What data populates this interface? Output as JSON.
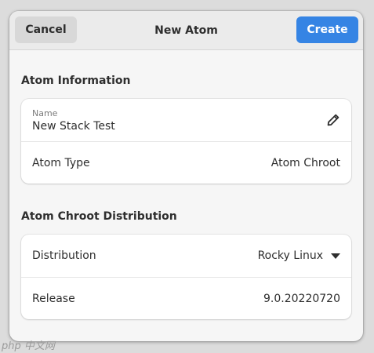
{
  "header": {
    "cancel_label": "Cancel",
    "title": "New Atom",
    "create_label": "Create"
  },
  "atom_info": {
    "section_title": "Atom Information",
    "name_label": "Name",
    "name_value": "New Stack Test",
    "edit_icon": "pencil-icon",
    "type_label": "Atom Type",
    "type_value": "Atom Chroot"
  },
  "distribution": {
    "section_title": "Atom Chroot Distribution",
    "distribution_label": "Distribution",
    "distribution_value": "Rocky Linux",
    "release_label": "Release",
    "release_value": "9.0.20220720"
  },
  "watermark": "php 中文网",
  "colors": {
    "accent": "#3584e4",
    "window_bg": "#f6f6f6",
    "card_bg": "#ffffff"
  }
}
